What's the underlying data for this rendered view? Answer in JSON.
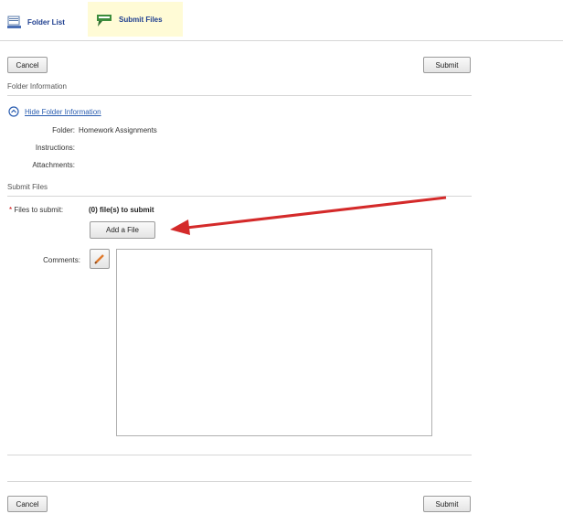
{
  "tabs": [
    {
      "label": "Folder List",
      "icon": "folder-list-icon",
      "active": false
    },
    {
      "label": "Submit Files",
      "icon": "submit-files-icon",
      "active": true
    }
  ],
  "top_actions": {
    "cancel": "Cancel",
    "submit": "Submit"
  },
  "folder_info": {
    "title": "Folder Information",
    "toggle_link": "Hide Folder Information",
    "folder_label": "Folder:",
    "folder_value": "Homework Assignments",
    "instructions_label": "Instructions:",
    "attachments_label": "Attachments:"
  },
  "submit_files": {
    "title": "Submit Files",
    "required_marker": "*",
    "files_label": "Files to submit:",
    "files_status": "(0) file(s) to submit",
    "add_file": "Add a File",
    "comments_label": "Comments:",
    "comments_value": ""
  },
  "bottom_actions": {
    "cancel": "Cancel",
    "submit": "Submit"
  },
  "colors": {
    "accent_arrow": "#d42a2a",
    "active_tab_bg": "#fffbd6",
    "link": "#2a5db0"
  }
}
